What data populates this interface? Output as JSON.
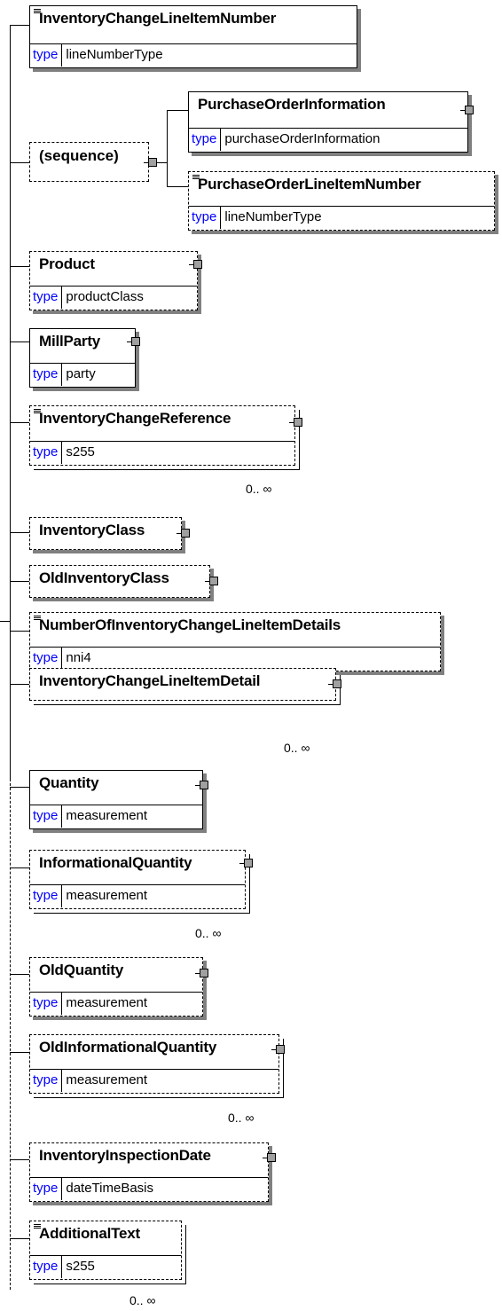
{
  "diagram": {
    "type_keyword": "type",
    "sequence_label": "(sequence)",
    "elements": [
      {
        "name": "InventoryChangeLineItemNumber",
        "type": "lineNumberType"
      },
      {
        "name": "PurchaseOrderInformation",
        "type": "purchaseOrderInformation"
      },
      {
        "name": "PurchaseOrderLineItemNumber",
        "type": "lineNumberType"
      },
      {
        "name": "Product",
        "type": "productClass"
      },
      {
        "name": "MillParty",
        "type": "party"
      },
      {
        "name": "InventoryChangeReference",
        "type": "s255",
        "cardinality": "0.. ∞"
      },
      {
        "name": "InventoryClass"
      },
      {
        "name": "OldInventoryClass"
      },
      {
        "name": "NumberOfInventoryChangeLineItemDetails",
        "type": "nni4"
      },
      {
        "name": "InventoryChangeLineItemDetail",
        "cardinality": "0.. ∞"
      },
      {
        "name": "Quantity",
        "type": "measurement"
      },
      {
        "name": "InformationalQuantity",
        "type": "measurement",
        "cardinality": "0.. ∞"
      },
      {
        "name": "OldQuantity",
        "type": "measurement"
      },
      {
        "name": "OldInformationalQuantity",
        "type": "measurement",
        "cardinality": "0.. ∞"
      },
      {
        "name": "InventoryInspectionDate",
        "type": "dateTimeBasis"
      },
      {
        "name": "AdditionalText",
        "type": "s255",
        "cardinality": "0.. ∞"
      }
    ]
  }
}
